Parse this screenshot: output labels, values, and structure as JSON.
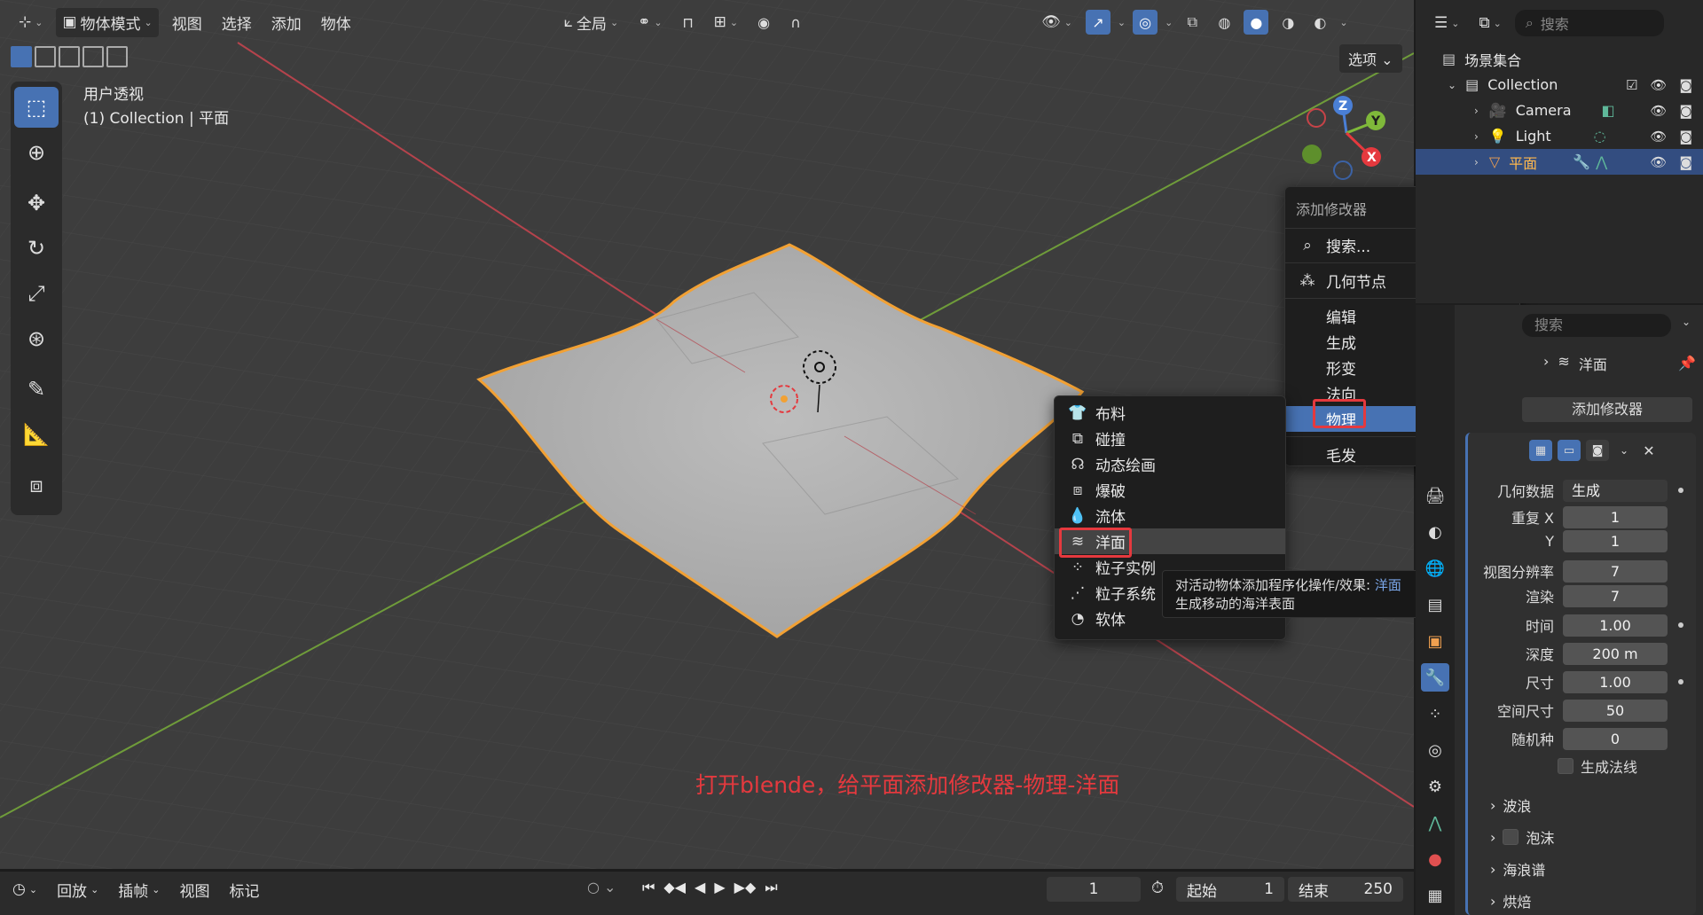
{
  "viewport": {
    "mode_label": "物体模式",
    "menus": [
      "视图",
      "选择",
      "添加",
      "物体"
    ],
    "transform_orientation": "全局",
    "options_label": "选项",
    "view_name": "用户透视",
    "view_collection": "(1) Collection | 平面",
    "gizmo": {
      "z": "Z",
      "y": "Y",
      "x": "X"
    }
  },
  "add_modifier_menu": {
    "title": "添加修改器",
    "search": "搜索...",
    "geometry_nodes": "几何节点",
    "categories": [
      "编辑",
      "生成",
      "形变",
      "法向",
      "物理",
      "毛发"
    ],
    "highlighted": "物理"
  },
  "physics_submenu": {
    "items": [
      {
        "label": "布料",
        "icon": "cloth-icon"
      },
      {
        "label": "碰撞",
        "icon": "collision-icon"
      },
      {
        "label": "动态绘画",
        "icon": "dynamic-paint-icon"
      },
      {
        "label": "爆破",
        "icon": "explode-icon"
      },
      {
        "label": "流体",
        "icon": "fluid-icon"
      },
      {
        "label": "洋面",
        "icon": "ocean-icon"
      },
      {
        "label": "粒子实例",
        "icon": "particle-instance-icon"
      },
      {
        "label": "粒子系统",
        "icon": "particle-system-icon"
      },
      {
        "label": "软体",
        "icon": "soft-body-icon"
      }
    ],
    "highlighted": "洋面"
  },
  "tooltip": {
    "line1": "对活动物体添加程序化操作/效果:",
    "line1_accent": "洋面",
    "line2": "生成移动的海洋表面"
  },
  "annotation": "打开blende，给平面添加修改器-物理-洋面",
  "timeline": {
    "playback": "回放",
    "keying": "插帧",
    "view": "视图",
    "marker": "标记",
    "current_frame": "1",
    "start_label": "起始",
    "start": "1",
    "end_label": "结束",
    "end": "250"
  },
  "outliner": {
    "search_placeholder": "搜索",
    "scene_collection": "场景集合",
    "collection": "Collection",
    "objects": [
      "Camera",
      "Light",
      "平面"
    ]
  },
  "properties": {
    "search_placeholder": "搜索",
    "breadcrumb": "洋面",
    "add_modifier": "添加修改器",
    "fields": [
      {
        "label": "几何数据",
        "value": "生成"
      },
      {
        "label": "重复 X",
        "value": "1"
      },
      {
        "label": "Y",
        "value": "1"
      },
      {
        "label": "视图分辨率",
        "value": "7"
      },
      {
        "label": "渲染",
        "value": "7"
      },
      {
        "label": "时间",
        "value": "1.00"
      },
      {
        "label": "深度",
        "value": "200 m"
      },
      {
        "label": "尺寸",
        "value": "1.00"
      },
      {
        "label": "空间尺寸",
        "value": "50"
      },
      {
        "label": "随机种",
        "value": "0"
      }
    ],
    "generate_normals": "生成法线",
    "sections": [
      "波浪",
      "泡沫",
      "海浪谱",
      "烘焙"
    ]
  }
}
